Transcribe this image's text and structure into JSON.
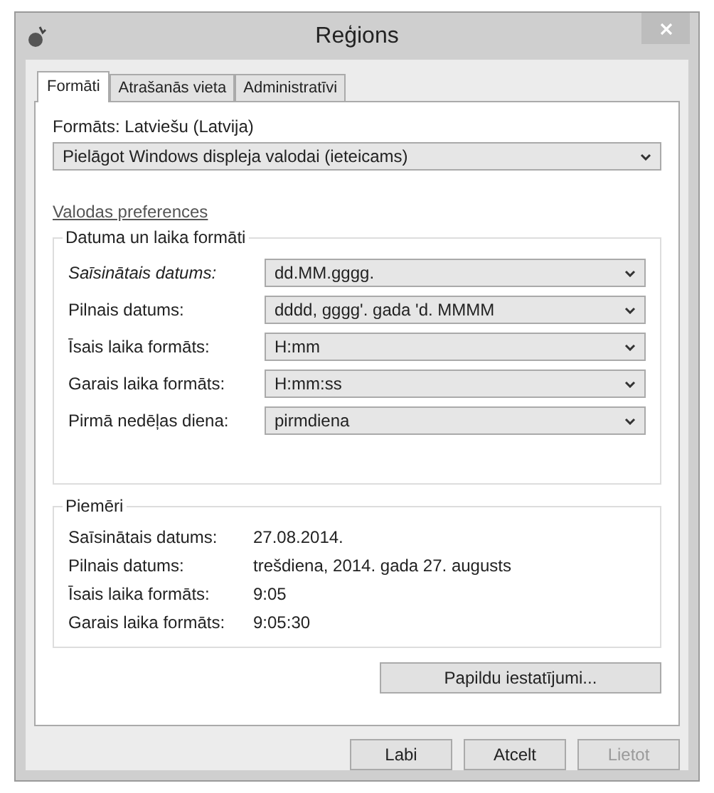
{
  "window": {
    "title": "Reģions"
  },
  "tabs": [
    {
      "label": "Formāti",
      "selected": true
    },
    {
      "label": "Atrašanās vieta",
      "selected": false
    },
    {
      "label": "Administratīvi",
      "selected": false
    }
  ],
  "format": {
    "label": "Formāts: Latviešu (Latvija)",
    "value": "Pielāgot Windows displeja valodai (ieteicams)"
  },
  "language_link": "Valodas preferences",
  "date_time_formats": {
    "title": "Datuma un laika formāti",
    "rows": [
      {
        "label": "Saīsinātais datums:",
        "value": "dd.MM.gggg.",
        "italic": true
      },
      {
        "label": "Pilnais datums:",
        "value": "dddd, gggg'. gada 'd. MMMM",
        "italic": false
      },
      {
        "label": "Īsais laika formāts:",
        "value": "H:mm",
        "italic": false
      },
      {
        "label": "Garais laika formāts:",
        "value": "H:mm:ss",
        "italic": false
      },
      {
        "label": "Pirmā nedēļas diena:",
        "value": "pirmdiena",
        "italic": false
      }
    ]
  },
  "examples": {
    "title": "Piemēri",
    "rows": [
      {
        "label": "Saīsinātais datums:",
        "value": "27.08.2014."
      },
      {
        "label": "Pilnais datums:",
        "value": "trešdiena, 2014. gada 27. augusts"
      },
      {
        "label": "Īsais laika formāts:",
        "value": "9:05"
      },
      {
        "label": "Garais laika formāts:",
        "value": "9:05:30"
      }
    ]
  },
  "additional_button": "Papildu iestatījumi...",
  "buttons": [
    {
      "label": "Labi",
      "disabled": false
    },
    {
      "label": "Atcelt",
      "disabled": false
    },
    {
      "label": "Lietot",
      "disabled": true
    }
  ]
}
